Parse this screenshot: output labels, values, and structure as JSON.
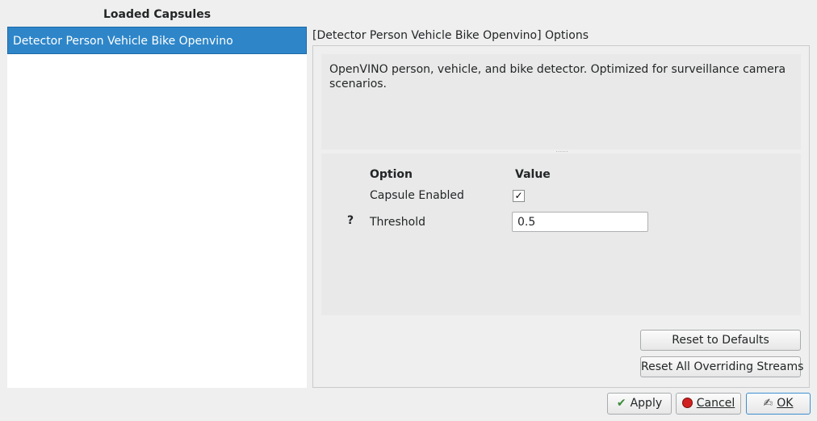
{
  "left_panel": {
    "title": "Loaded Capsules",
    "items": [
      {
        "label": "Detector Person Vehicle Bike Openvino",
        "selected": true
      }
    ]
  },
  "right_panel": {
    "title": "[Detector Person Vehicle Bike Openvino] Options",
    "description": "OpenVINO person, vehicle, and bike detector. Optimized for surveillance camera scenarios.",
    "splitter_handle": "......",
    "options": {
      "header_option": "Option",
      "header_value": "Value",
      "rows": [
        {
          "help": "",
          "name": "Capsule Enabled",
          "type": "checkbox",
          "checked": true,
          "check_glyph": "✓"
        },
        {
          "help": "?",
          "name": "Threshold",
          "type": "text",
          "value": "0.5"
        }
      ]
    },
    "reset_defaults_label": "Reset to Defaults",
    "reset_streams_label": "Reset All Overriding Streams"
  },
  "footer": {
    "apply": {
      "label": "Apply",
      "icon": "checkmark-icon",
      "glyph": "✔"
    },
    "cancel": {
      "label": "Cancel",
      "icon": "cancel-icon"
    },
    "ok": {
      "label": "OK",
      "icon": "ok-icon",
      "glyph": "✍"
    }
  },
  "colors": {
    "selection": "#2e86c9",
    "window_bg": "#efefef",
    "panel_bg": "#e9e9e9"
  }
}
